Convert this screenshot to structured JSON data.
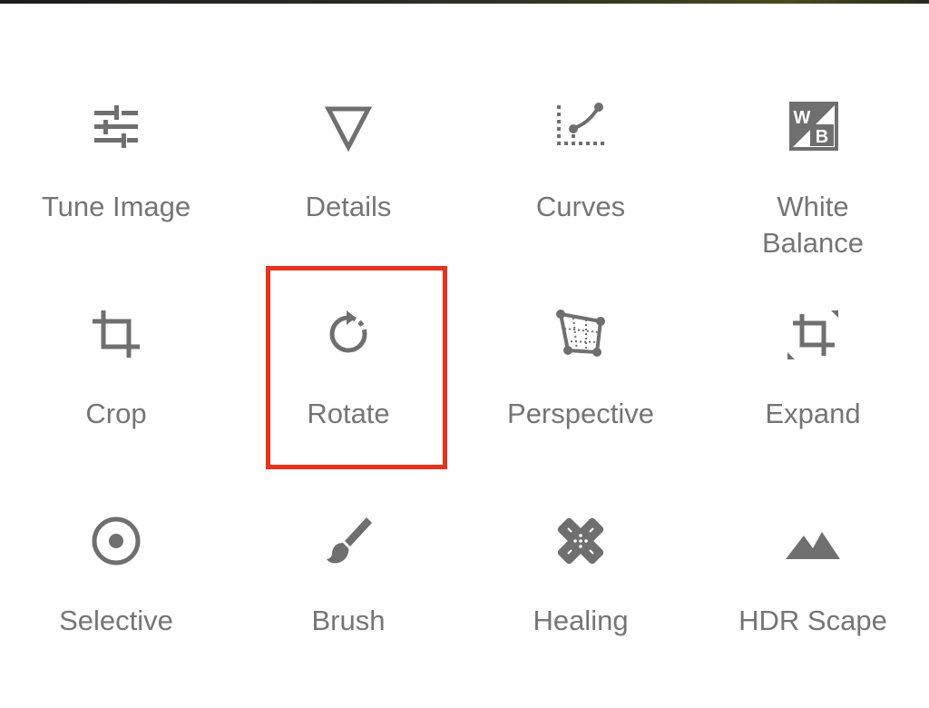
{
  "tools": [
    {
      "name": "tool-tune-image",
      "icon": "sliders-icon",
      "label": "Tune Image"
    },
    {
      "name": "tool-details",
      "icon": "triangle-icon",
      "label": "Details"
    },
    {
      "name": "tool-curves",
      "icon": "curves-icon",
      "label": "Curves"
    },
    {
      "name": "tool-white-balance",
      "icon": "white-balance-icon",
      "label": "White\nBalance"
    },
    {
      "name": "tool-crop",
      "icon": "crop-icon",
      "label": "Crop"
    },
    {
      "name": "tool-rotate",
      "icon": "rotate-icon",
      "label": "Rotate"
    },
    {
      "name": "tool-perspective",
      "icon": "perspective-icon",
      "label": "Perspective"
    },
    {
      "name": "tool-expand",
      "icon": "expand-icon",
      "label": "Expand"
    },
    {
      "name": "tool-selective",
      "icon": "selective-icon",
      "label": "Selective"
    },
    {
      "name": "tool-brush",
      "icon": "brush-icon",
      "label": "Brush"
    },
    {
      "name": "tool-healing",
      "icon": "healing-icon",
      "label": "Healing"
    },
    {
      "name": "tool-hdr-scape",
      "icon": "mountains-icon",
      "label": "HDR Scape"
    }
  ],
  "icon_glyphs": {
    "white_balance_w": "W",
    "white_balance_b": "B"
  },
  "highlight": {
    "target": "tool-rotate",
    "color": "#e8321c"
  },
  "colors": {
    "icon": "#6f6f6f",
    "label": "#757575",
    "background": "#ffffff"
  }
}
